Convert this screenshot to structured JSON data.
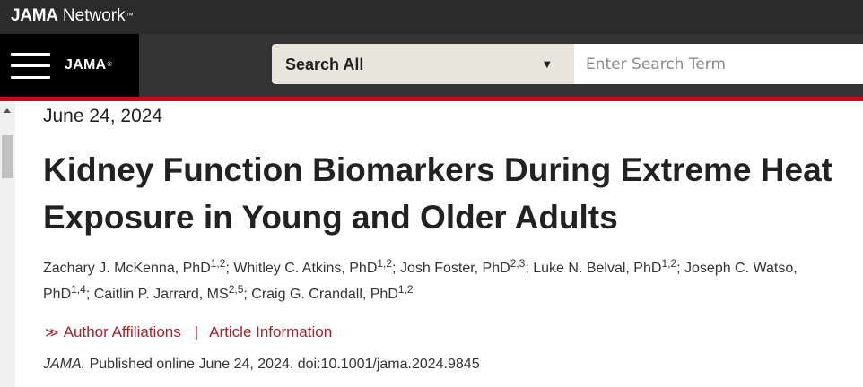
{
  "topbar": {
    "brand_bold": "JAMA",
    "brand_light": " Network",
    "trademark": "™"
  },
  "navbar": {
    "menu_icon": "hamburger-menu-icon",
    "logo": "JAMA",
    "logo_mark": "®",
    "search_scope": "Search All",
    "search_caret": "▼",
    "search_placeholder": "Enter Search Term"
  },
  "colors": {
    "accent_red": "#d0021b",
    "link_red": "#a3262e",
    "topbar_bg": "#2b2b2b",
    "navbar_bg": "#333333",
    "select_bg": "#e8e6dc"
  },
  "article": {
    "date": "June 24, 2024",
    "title": "Kidney Function Biomarkers During Extreme Heat Exposure in Young and Older Adults",
    "authors": [
      {
        "name": "Zachary J. McKenna, PhD",
        "sup": "1,2"
      },
      {
        "name": "Whitley C. Atkins, PhD",
        "sup": "1,2"
      },
      {
        "name": "Josh Foster, PhD",
        "sup": "2,3"
      },
      {
        "name": "Luke N. Belval, PhD",
        "sup": "1,2"
      },
      {
        "name": "Joseph C. Watso, PhD",
        "sup": "1,4"
      },
      {
        "name": "Caitlin P. Jarrard, MS",
        "sup": "2,5"
      },
      {
        "name": "Craig G. Crandall, PhD",
        "sup": "1,2"
      }
    ],
    "author_separator": "; ",
    "links": {
      "chevron": "≫",
      "affiliations": "Author Affiliations",
      "separator": "|",
      "information": "Article Information"
    },
    "citation": {
      "journal": "JAMA.",
      "text": " Published online June 24, 2024. doi:10.1001/jama.2024.9845"
    }
  }
}
